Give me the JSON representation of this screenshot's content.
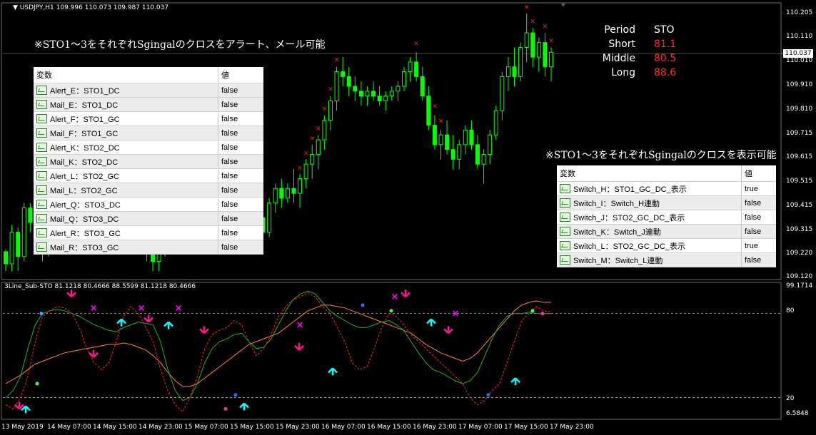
{
  "header": {
    "symbol_info": "USDJPY,H1  109.996 110.073 109.987 110.037"
  },
  "subwindow": {
    "title": "3Line_Sub-STO 81.1218 80.4666 88.5599 81.1218 80.4666"
  },
  "notes": {
    "alert_note": "※STO1～3をそれぞれSgingalのクロスをアラート、メール可能",
    "display_note": "※STO1～3をそれぞれSgingalのクロスを表示可能"
  },
  "sto_panel": {
    "header": {
      "label": "Period",
      "value": "STO"
    },
    "rows": [
      {
        "label": "Short",
        "value": "81.1"
      },
      {
        "label": "Middle",
        "value": "80.5"
      },
      {
        "label": "Long",
        "value": "88.6"
      }
    ]
  },
  "left_params": {
    "col_var": "変数",
    "col_val": "値",
    "rows": [
      {
        "name": "Alert_E：STO1_DC",
        "value": "false"
      },
      {
        "name": "Mail_E：STO1_DC",
        "value": "false"
      },
      {
        "name": "Alert_F：STO1_GC",
        "value": "false"
      },
      {
        "name": "Mail_F：STO1_GC",
        "value": "false"
      },
      {
        "name": "Alert_K：STO2_DC",
        "value": "false"
      },
      {
        "name": "Mail_K：STO2_DC",
        "value": "false"
      },
      {
        "name": "Alert_L：STO2_GC",
        "value": "false"
      },
      {
        "name": "Mail_L：STO2_GC",
        "value": "false"
      },
      {
        "name": "Alert_Q：STO3_DC",
        "value": "false"
      },
      {
        "name": "Mail_Q：STO3_DC",
        "value": "false"
      },
      {
        "name": "Alert_R：STO3_GC",
        "value": "false"
      },
      {
        "name": "Mail_R：STO3_GC",
        "value": "false"
      }
    ]
  },
  "right_params": {
    "col_var": "変数",
    "col_val": "値",
    "rows": [
      {
        "name": "Switch_H：STO1_GC_DC_表示",
        "value": "true"
      },
      {
        "name": "Switch_I：Switch_H連動",
        "value": "false"
      },
      {
        "name": "Switch_J：STO2_GC_DC_表示",
        "value": "false"
      },
      {
        "name": "Switch_K：Switch_J連動",
        "value": "false"
      },
      {
        "name": "Switch_L：STO2_GC_DC_表示",
        "value": "true"
      },
      {
        "name": "Switch_M：Switch_L連動",
        "value": "false"
      }
    ]
  },
  "price_axis": [
    "110.205",
    "110.110",
    "110.010",
    "109.910",
    "109.810",
    "109.715",
    "109.615",
    "109.515",
    "109.415",
    "109.315",
    "109.220",
    "109.120"
  ],
  "current_price": "110.037",
  "sub_axis": [
    "99.1714",
    "80",
    "20",
    "6.5848"
  ],
  "time_axis": [
    "13 May 2019",
    "14 May 07:00",
    "14 May 15:00",
    "14 May 23:00",
    "15 May 07:00",
    "15 May 15:00",
    "15 May 23:00",
    "16 May 07:00",
    "16 May 15:00",
    "16 May 23:00",
    "17 May 07:00",
    "17 May 15:00",
    "17 May 23:00"
  ],
  "colors": {
    "bull": "#ffffff",
    "bear": "#00ff00",
    "sto_short": "#ff2020",
    "sto_mid": "#20b020",
    "sto_long": "#ff7f40",
    "sell_arrow": "#ff1493",
    "buy_arrow": "#00ffff",
    "cross_mark": "#ff00ff"
  },
  "chart_data": {
    "type": "candlestick",
    "note": "USDJPY H1 price candles (approximate OHLC)",
    "ylim": [
      109.12,
      110.205
    ],
    "candles": [
      [
        109.22,
        109.23,
        109.14,
        109.17
      ],
      [
        109.17,
        109.33,
        109.14,
        109.3
      ],
      [
        109.3,
        109.32,
        109.14,
        109.2
      ],
      [
        109.2,
        109.42,
        109.18,
        109.4
      ],
      [
        109.4,
        109.42,
        109.3,
        109.34
      ],
      [
        109.34,
        109.38,
        109.22,
        109.28
      ],
      [
        109.28,
        109.32,
        109.18,
        109.24
      ],
      [
        109.24,
        109.34,
        109.2,
        109.3
      ],
      [
        109.3,
        109.52,
        109.28,
        109.5
      ],
      [
        109.5,
        109.58,
        109.44,
        109.48
      ],
      [
        109.48,
        109.56,
        109.42,
        109.54
      ],
      [
        109.54,
        109.6,
        109.48,
        109.52
      ],
      [
        109.52,
        109.58,
        109.46,
        109.5
      ],
      [
        109.5,
        109.56,
        109.42,
        109.46
      ],
      [
        109.46,
        109.52,
        109.4,
        109.44
      ],
      [
        109.44,
        109.5,
        109.36,
        109.4
      ],
      [
        109.4,
        109.46,
        109.34,
        109.42
      ],
      [
        109.42,
        109.5,
        109.38,
        109.46
      ],
      [
        109.46,
        109.52,
        109.4,
        109.44
      ],
      [
        109.44,
        109.48,
        109.3,
        109.34
      ],
      [
        109.34,
        109.4,
        109.24,
        109.28
      ],
      [
        109.28,
        109.36,
        109.22,
        109.32
      ],
      [
        109.32,
        109.38,
        109.26,
        109.3
      ],
      [
        109.3,
        109.34,
        109.18,
        109.22
      ],
      [
        109.22,
        109.28,
        109.14,
        109.18
      ],
      [
        109.18,
        109.26,
        109.14,
        109.24
      ],
      [
        109.24,
        109.34,
        109.2,
        109.32
      ],
      [
        109.32,
        109.44,
        109.3,
        109.42
      ],
      [
        109.42,
        109.52,
        109.38,
        109.5
      ],
      [
        109.5,
        109.58,
        109.46,
        109.56
      ],
      [
        109.56,
        109.6,
        109.48,
        109.52
      ],
      [
        109.52,
        109.58,
        109.5,
        109.56
      ],
      [
        109.56,
        109.6,
        109.52,
        109.55
      ],
      [
        109.55,
        109.58,
        109.46,
        109.48
      ],
      [
        109.48,
        109.52,
        109.4,
        109.44
      ],
      [
        109.44,
        109.5,
        109.4,
        109.48
      ],
      [
        109.48,
        109.52,
        109.42,
        109.46
      ],
      [
        109.46,
        109.5,
        109.38,
        109.4
      ],
      [
        109.4,
        109.46,
        109.36,
        109.44
      ],
      [
        109.44,
        109.52,
        109.42,
        109.5
      ],
      [
        109.5,
        109.52,
        109.38,
        109.4
      ],
      [
        109.4,
        109.44,
        109.32,
        109.36
      ],
      [
        109.36,
        109.4,
        109.28,
        109.3
      ],
      [
        109.3,
        109.44,
        109.28,
        109.42
      ],
      [
        109.42,
        109.5,
        109.38,
        109.48
      ],
      [
        109.48,
        109.52,
        109.4,
        109.44
      ],
      [
        109.44,
        109.5,
        109.42,
        109.48
      ],
      [
        109.48,
        109.56,
        109.42,
        109.46
      ],
      [
        109.46,
        109.54,
        109.4,
        109.52
      ],
      [
        109.52,
        109.6,
        109.48,
        109.58
      ],
      [
        109.58,
        109.66,
        109.52,
        109.62
      ],
      [
        109.62,
        109.7,
        109.56,
        109.68
      ],
      [
        109.68,
        109.78,
        109.64,
        109.76
      ],
      [
        109.76,
        109.86,
        109.72,
        109.84
      ],
      [
        109.84,
        109.98,
        109.8,
        109.96
      ],
      [
        109.96,
        110.02,
        109.9,
        109.94
      ],
      [
        109.94,
        109.98,
        109.86,
        109.9
      ],
      [
        109.9,
        109.94,
        109.84,
        109.88
      ],
      [
        109.88,
        109.92,
        109.82,
        109.86
      ],
      [
        109.86,
        109.9,
        109.82,
        109.88
      ],
      [
        109.88,
        109.92,
        109.84,
        109.86
      ],
      [
        109.86,
        109.9,
        109.82,
        109.84
      ],
      [
        109.84,
        109.88,
        109.8,
        109.86
      ],
      [
        109.86,
        109.9,
        109.84,
        109.88
      ],
      [
        109.88,
        109.92,
        109.84,
        109.9
      ],
      [
        109.9,
        109.98,
        109.88,
        109.96
      ],
      [
        109.96,
        110.02,
        109.92,
        110.0
      ],
      [
        110.0,
        110.04,
        109.92,
        109.94
      ],
      [
        109.94,
        109.98,
        109.84,
        109.86
      ],
      [
        109.86,
        109.9,
        109.72,
        109.74
      ],
      [
        109.74,
        109.78,
        109.64,
        109.66
      ],
      [
        109.66,
        109.72,
        109.6,
        109.7
      ],
      [
        109.7,
        109.76,
        109.62,
        109.64
      ],
      [
        109.64,
        109.7,
        109.56,
        109.6
      ],
      [
        109.6,
        109.68,
        109.56,
        109.66
      ],
      [
        109.66,
        109.74,
        109.62,
        109.72
      ],
      [
        109.72,
        109.76,
        109.64,
        109.66
      ],
      [
        109.66,
        109.7,
        109.56,
        109.58
      ],
      [
        109.58,
        109.64,
        109.5,
        109.62
      ],
      [
        109.62,
        109.72,
        109.58,
        109.7
      ],
      [
        109.7,
        109.82,
        109.68,
        109.8
      ],
      [
        109.8,
        109.96,
        109.76,
        109.94
      ],
      [
        109.94,
        110.02,
        109.88,
        109.98
      ],
      [
        109.98,
        110.06,
        109.9,
        109.94
      ],
      [
        109.94,
        110.08,
        109.92,
        110.06
      ],
      [
        110.06,
        110.2,
        110.0,
        110.12
      ],
      [
        110.12,
        110.14,
        109.98,
        110.02
      ],
      [
        110.02,
        110.1,
        109.96,
        110.08
      ],
      [
        110.08,
        110.12,
        109.94,
        109.98
      ],
      [
        109.98,
        110.06,
        109.92,
        110.04
      ]
    ]
  }
}
